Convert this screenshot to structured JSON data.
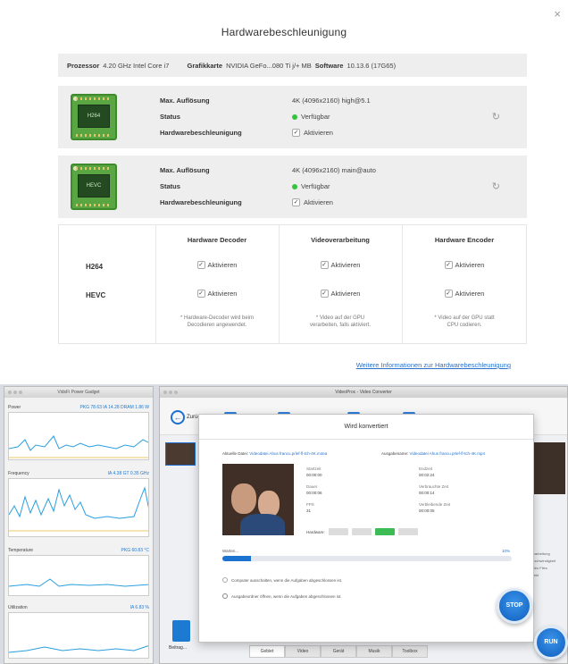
{
  "dialog": {
    "title": "Hardwarebeschleunigung",
    "close_label": "×"
  },
  "info": {
    "processor_label": "Prozessor",
    "processor_value": "4.20 GHz Intel Core i7",
    "gpu_label": "Grafikkarte",
    "gpu_value": "NVIDIA GeFo...080 Ti j/+ MB",
    "software_label": "Software",
    "software_value": "10.13.6 (17G65)"
  },
  "codecs": [
    {
      "chip_label": "H264",
      "max_res_label": "Max. Auflösung",
      "max_res_value": "4K (4096x2160) high@5.1",
      "status_label": "Status",
      "status_value": "Verfügbar",
      "hw_label": "Hardwarebeschleunigung",
      "hw_value": "Aktivieren"
    },
    {
      "chip_label": "HEVC",
      "max_res_label": "Max. Auflösung",
      "max_res_value": "4K (4096x2160) main@auto",
      "status_label": "Status",
      "status_value": "Verfügbar",
      "hw_label": "Hardwarebeschleunigung",
      "hw_value": "Aktivieren"
    }
  ],
  "matrix": {
    "columns": [
      "Hardware Decoder",
      "Videoverarbeitung",
      "Hardware Encoder"
    ],
    "rows": [
      "H264",
      "HEVC"
    ],
    "cell_label": "Aktivieren",
    "notes": [
      "* Hardware-Decoder wird beim\nDecodieren angewendet.",
      "* Video auf der GPU\nverarbeiten, falls aktiviert.",
      "* Video auf der GPU statt\nCPU codieren."
    ]
  },
  "more_link": "Weitere Informationen zur Hardwarebeschleunigung",
  "monitor": {
    "title": "VidsFi Power Gadget",
    "power": {
      "label": "Power",
      "value": "PKG 78.63  IA 14.28  DRAM 1.86  W"
    },
    "frequency": {
      "label": "Frequency",
      "value": "IA 4.38  GT 0.35  GHz"
    },
    "temperature": {
      "label": "Temperature",
      "value": "PKG 60.83 °C"
    },
    "utilization": {
      "label": "Utilization",
      "value": "IA 6.83 %"
    }
  },
  "converter": {
    "window_title": "VideoProc - Video Converter",
    "back_label": "Zurück",
    "file_label": "Beitrag...",
    "bottom_tabs": [
      "Gebiet",
      "Video",
      "Gerät",
      "Musik",
      "Toolbox"
    ],
    "right_list": [
      "Verarbeitung",
      "Geschwindigkeit",
      "Video Files",
      "Effekt"
    ]
  },
  "convert_modal": {
    "title": "Wird konvertiert",
    "src_label": "Aktuelle Datei:",
    "src_path": "Videodatei Ahus francu.prlef-fl-tch-4K.m4ea",
    "dst_label": "Ausgabename:",
    "dst_path": "Videodatei Ahus francu.prlef-fl-tch-4K.mp4",
    "k1": "Startzeit",
    "v1": "00:00:00",
    "k2": "Dauer",
    "v2": "00:00:06",
    "k3": "FPS",
    "v3": "31",
    "k4": "Endzeit",
    "v4": "00:02:24",
    "k5": "Verbrauchte Zeit",
    "v5": "00:00:14",
    "k6": "Verbleibende Zeit",
    "v6": "00:00:05",
    "hw_label": "Hardware:",
    "progress_label": "Warten...",
    "progress_pct": "10%",
    "progress_fraction": 0.1,
    "opt1": "Computer ausschalten, wenn die Aufgaben abgeschlossen ist.",
    "opt2": "Ausgabeordner öffnen, wenn die Aufgaben abgeschlossen ist.",
    "stop_label": "STOP",
    "run_label": "RUN"
  },
  "colors": {
    "accent": "#2a72c9",
    "chip_green": "#5aa642",
    "status_green": "#35c33e"
  }
}
